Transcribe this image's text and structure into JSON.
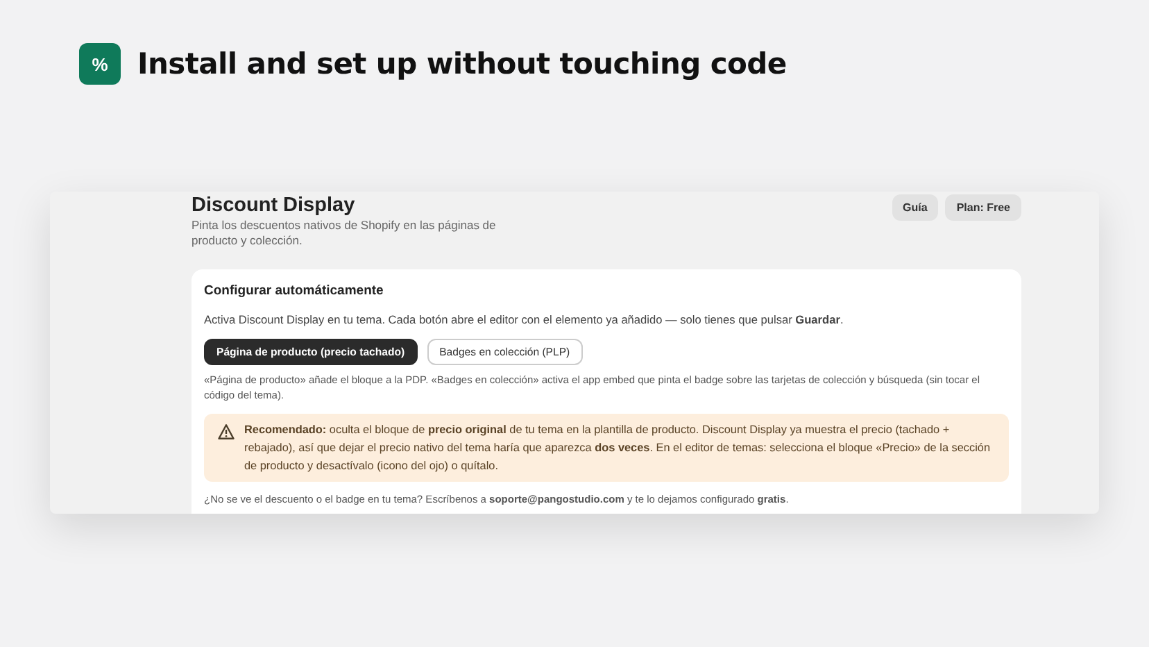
{
  "headline": {
    "icon": "%",
    "title": "Install and set up without touching code"
  },
  "app": {
    "title": "Discount Display",
    "subtitle": "Pinta los descuentos nativos de Shopify en las páginas de producto y colección.",
    "header_buttons": [
      "Guía",
      "Plan: Free"
    ],
    "card": {
      "title": "Configurar automáticamente",
      "intro": "Activa Discount Display en tu tema. Cada botón abre el editor con el elemento ya añadido — solo tienes que pulsar **Guardar**.",
      "buttons": [
        {
          "label": "Página de producto (precio tachado)",
          "selected": true
        },
        {
          "label": "Badges en colección (PLP)",
          "selected": false
        }
      ],
      "note": "«Página de producto» añade el bloque a la PDP. «Badges en colección» activa el app embed que pinta el badge sobre las tarjetas de colección y búsqueda (sin tocar el código del tema).",
      "warning": "**Recomendado:** oculta el bloque de **precio original** de tu tema en la plantilla de producto. Discount Display ya muestra el precio (tachado + rebajado), así que dejar el precio nativo del tema haría que aparezca **dos veces**. En el editor de temas: selecciona el bloque «Precio» de la sección de producto y desactívalo (icono del ojo) o quítalo.",
      "footer": "¿No se ve el descuento o el badge en tu tema? Escríbenos a **soporte@pangostudio.com** y te lo dejamos configurado **gratis**."
    }
  }
}
